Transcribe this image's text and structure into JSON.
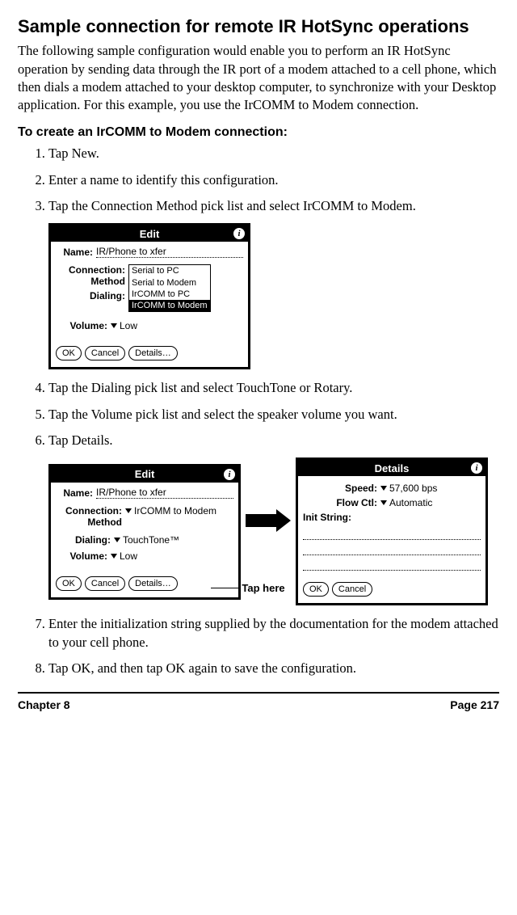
{
  "heading": "Sample connection for remote IR HotSync operations",
  "intro": "The following sample configuration would enable you to perform an IR HotSync operation by sending data through the IR port of a modem attached to a cell phone, which then dials a modem attached to your desktop computer, to synchronize with your Desktop application. For this example, you use the IrCOMM to Modem connection.",
  "subhead": "To create an IrCOMM to Modem connection:",
  "steps": [
    "Tap New.",
    "Enter a name to identify this configuration.",
    "Tap the Connection Method pick list and select IrCOMM to Modem.",
    "Tap the Dialing pick list and select TouchTone or Rotary.",
    "Tap the Volume pick list and select the speaker volume you want.",
    "Tap Details.",
    "Enter the initialization string supplied by the documentation for the modem attached to your cell phone.",
    "Tap OK, and then tap OK again to save the configuration."
  ],
  "fig1": {
    "title": "Edit",
    "name_label": "Name:",
    "name_value": "IR/Phone to xfer",
    "conn_label1": "Connection:",
    "conn_label2": "Method",
    "dropdown": [
      "Serial to PC",
      "Serial to Modem",
      "IrCOMM to PC",
      "IrCOMM to Modem"
    ],
    "dropdown_selected_index": 3,
    "dialing_label": "Dialing:",
    "volume_label": "Volume:",
    "volume_value": "Low",
    "btn_ok": "OK",
    "btn_cancel": "Cancel",
    "btn_details": "Details…"
  },
  "fig2a": {
    "title": "Edit",
    "name_label": "Name:",
    "name_value": "IR/Phone to xfer",
    "conn_label1": "Connection:",
    "conn_label2": "Method",
    "conn_value": "IrCOMM to Modem",
    "dialing_label": "Dialing:",
    "dialing_value": "TouchTone™",
    "volume_label": "Volume:",
    "volume_value": "Low",
    "btn_ok": "OK",
    "btn_cancel": "Cancel",
    "btn_details": "Details…"
  },
  "tap_here": "Tap here",
  "fig2b": {
    "title": "Details",
    "speed_label": "Speed:",
    "speed_value": "57,600 bps",
    "flow_label": "Flow Ctl:",
    "flow_value": "Automatic",
    "init_label": "Init String:",
    "btn_ok": "OK",
    "btn_cancel": "Cancel"
  },
  "footer_left": "Chapter 8",
  "footer_right": "Page 217"
}
